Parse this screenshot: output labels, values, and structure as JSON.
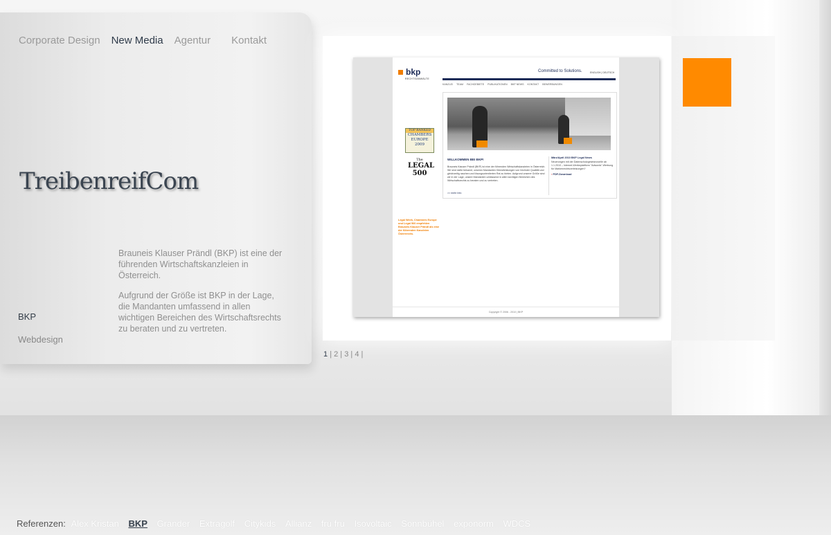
{
  "nav": {
    "items": [
      "Corporate Design",
      "New Media",
      "Agentur",
      "Kontakt"
    ],
    "active_index": 1
  },
  "logo_text": "TreibenreifCom",
  "project": {
    "client": "BKP",
    "category": "Webdesign",
    "description": [
      "Brauneis Klauser Prändl (BKP) ist eine der führenden Wirtschaftskanzleien in Österreich.",
      "Aufgrund der Größe ist BKP in der Lage, die Mandanten umfassend in allen wichtigen Bereichen des Wirtschaftsrechts zu beraten und zu vertreten."
    ]
  },
  "preview": {
    "logo_word": "bkp",
    "logo_sub": "RECHTSANWÄLTE",
    "tagline": "Committed to Solutions.",
    "lang": "ENGLISH | DEUTSCH",
    "menu": [
      "KANZLEI",
      "TEAM",
      "FACHGEBIETE",
      "PUBLIKATIONEN",
      "BKP NEWS",
      "KONTAKT",
      "BEWERBUNGEN"
    ],
    "welcome_title": "WILLKOMMEN BEI BKP!",
    "welcome_text": "Brauneis Klauser Prändl (BKP) ist eine der führenden Wirtschaftskanzleien in Österreich. Wir sind dafür bekannt, unseren Mandanten Dienstleistungen von höchster Qualität und gleichzeitig raschen und lösungsorientierten Rat zu bieten. Aufgrund unserer Größe sind wir in der Lage, unsere Mandanten umfassend in allen wichtigen Bereichen des Wirtschaftsrechts zu beraten und zu vertreten.",
    "more_link": ">> mehr Info",
    "news_title": "März/April 2010 BKP Legal News",
    "news_text": "Neuerungen mit der Datenschutzgesetznovelle ab 1.1.2010 – Internet-Werbeplattform \"Adwords\"-Werbung für Markenrechtsverletzungen?",
    "pdf_link": "PDF-Download",
    "badge_chambers_top": "TOP RANKED",
    "badge_chambers_main": "CHAMBERS EUROPE",
    "badge_chambers_year": "2009",
    "badge_legal_the": "The",
    "badge_legal_main": "LEGAL 500",
    "orange_text": "Legal Week, Chambers Europe und Legal 500 empfehlen Brauneis Klauser Prändl als eine der führenden Kanzleien Österreichs.",
    "copyright": "Copyright © 2006 - 2010 | BKP"
  },
  "pager": {
    "pages": [
      "1",
      "2",
      "3",
      "4"
    ],
    "active_index": 0,
    "separator": "|"
  },
  "references": {
    "label": "Referenzen:",
    "items": [
      "Alex Kristan",
      "BKP",
      "Grander",
      "Extragolf",
      "Citykids",
      "Allianz",
      "fru fru",
      "Isovoltaic",
      "Sonnbühel",
      "exponorm",
      "WDCS"
    ],
    "active_index": 1
  },
  "colors": {
    "accent_orange": "#ff8a00",
    "nav_active": "#2f3b4a",
    "nav_inactive": "#9a9a9a",
    "bkp_navy": "#1c2b57"
  }
}
